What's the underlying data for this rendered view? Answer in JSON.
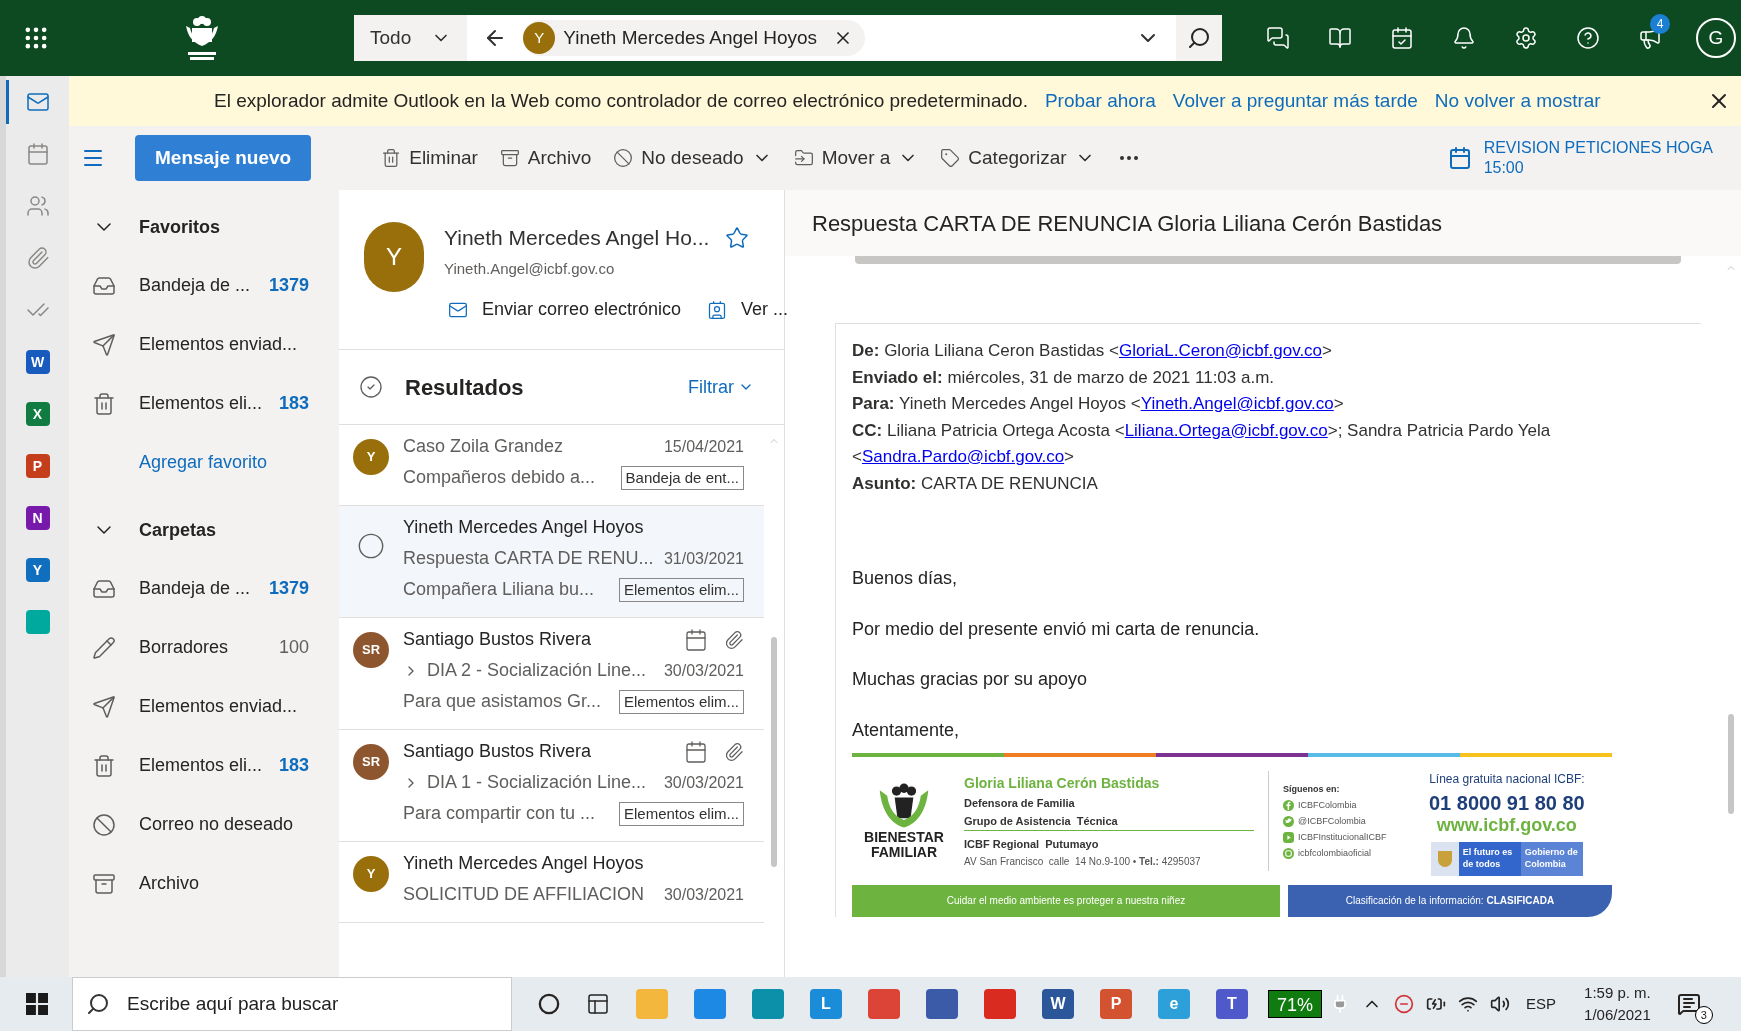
{
  "app_bar": {
    "search_scope": "Todo",
    "search_chip": {
      "initial": "Y",
      "name": "Yineth Mercedes Angel Hoyos"
    },
    "icons": [
      {
        "kind": "chat"
      },
      {
        "kind": "office"
      },
      {
        "kind": "todo"
      },
      {
        "kind": "bell"
      },
      {
        "kind": "settings"
      },
      {
        "kind": "help"
      },
      {
        "kind": "megaphone",
        "badge": "4"
      }
    ],
    "profile_initial": "G"
  },
  "rail": [
    {
      "kind": "mail",
      "selected": true
    },
    {
      "kind": "calendar",
      "selected": false
    },
    {
      "kind": "people",
      "selected": false
    },
    {
      "kind": "attach",
      "selected": false
    },
    {
      "kind": "todo",
      "selected": false
    },
    {
      "kind": "tile",
      "letter": "W",
      "color": "#185abd",
      "selected": false
    },
    {
      "kind": "tile",
      "letter": "X",
      "color": "#107c41",
      "selected": false
    },
    {
      "kind": "tile",
      "letter": "P",
      "color": "#c43e1c",
      "selected": false
    },
    {
      "kind": "tile",
      "letter": "N",
      "color": "#7719aa",
      "selected": false
    },
    {
      "kind": "tile",
      "letter": "Y",
      "color": "#106ebe",
      "selected": false
    },
    {
      "kind": "tile",
      "color": "#00a99d",
      "selected": false
    }
  ],
  "banner": {
    "message": "El explorador admite Outlook en la Web como controlador de correo electrónico predeterminado.",
    "links": [
      "Probar ahora",
      "Volver a preguntar más tarde",
      "No volver a mostrar"
    ]
  },
  "toolbar": {
    "new_message": "Mensaje nuevo",
    "actions": [
      {
        "kind": "delete",
        "label": "Eliminar",
        "dropdown": false
      },
      {
        "kind": "archive",
        "label": "Archivo",
        "dropdown": false
      },
      {
        "kind": "junk",
        "label": "No deseado",
        "dropdown": true
      },
      {
        "kind": "move",
        "label": "Mover a",
        "dropdown": true
      },
      {
        "kind": "tag",
        "label": "Categorizar",
        "dropdown": true
      }
    ],
    "reminder": {
      "title": "REVISION PETICIONES HOGA",
      "time": "15:00"
    }
  },
  "folders": [
    {
      "title": "Favoritos",
      "expanded": true,
      "items": [
        {
          "kind": "inbox",
          "label": "Bandeja de ...",
          "count": "1379",
          "unread": true
        },
        {
          "kind": "sent",
          "label": "Elementos enviad..."
        },
        {
          "kind": "deleted",
          "label": "Elementos eli...",
          "count": "183",
          "unread": true
        }
      ],
      "add_link": "Agregar favorito"
    },
    {
      "title": "Carpetas",
      "expanded": true,
      "items": [
        {
          "kind": "inbox",
          "label": "Bandeja de ...",
          "count": "1379",
          "unread": true
        },
        {
          "kind": "drafts",
          "label": "Borradores",
          "count": "100",
          "unread": false
        },
        {
          "kind": "sent",
          "label": "Elementos enviad..."
        },
        {
          "kind": "deleted",
          "label": "Elementos eli...",
          "count": "183",
          "unread": true
        },
        {
          "kind": "junk",
          "label": "Correo no deseado"
        },
        {
          "kind": "archive",
          "label": "Archivo"
        }
      ]
    }
  ],
  "contact_card": {
    "initial": "Y",
    "name": "Yineth Mercedes Angel Ho...",
    "email": "Yineth.Angel@icbf.gov.co",
    "actions": [
      {
        "kind": "mail",
        "label": "Enviar correo electrónico"
      },
      {
        "kind": "card",
        "label": "Ver ..."
      }
    ]
  },
  "results": {
    "title": "Resultados",
    "filter": "Filtrar"
  },
  "messages": [
    {
      "avatar": "Y",
      "color": "#986f0b",
      "subject": "Caso Zoila Grandez",
      "date": "15/04/2021",
      "preview": "Compañeros debido a...",
      "folder": "Bandeja de ent...",
      "selected": false,
      "thread": false,
      "calendar": false,
      "attachment": false
    },
    {
      "sender": "Yineth Mercedes Angel Hoyos",
      "subject": "Respuesta CARTA DE RENU...",
      "date": "31/03/2021",
      "preview": "Compañera Liliana bu...",
      "folder": "Elementos elim...",
      "selected": true,
      "thread": false,
      "calendar": false,
      "attachment": false
    },
    {
      "avatar": "SR",
      "color": "#8e562e",
      "sender": "Santiago Bustos Rivera",
      "subject": "DIA 2 - Socialización Line...",
      "date": "30/03/2021",
      "preview": "Para que asistamos Gr...",
      "folder": "Elementos elim...",
      "selected": false,
      "thread": true,
      "calendar": true,
      "attachment": true
    },
    {
      "avatar": "SR",
      "color": "#8e562e",
      "sender": "Santiago Bustos Rivera",
      "subject": "DIA 1 - Socialización Line...",
      "date": "30/03/2021",
      "preview": "Para compartir con tu ...",
      "folder": "Elementos elim...",
      "selected": false,
      "thread": true,
      "calendar": true,
      "attachment": true
    },
    {
      "avatar": "Y",
      "color": "#986f0b",
      "sender": "Yineth Mercedes Angel Hoyos",
      "subject": "SOLICITUD DE AFFILIACION",
      "date": "30/03/2021",
      "selected": false,
      "thread": false,
      "calendar": false,
      "attachment": false
    }
  ],
  "reading": {
    "subject": "Respuesta CARTA DE RENUNCIA Gloria Liliana Cerón Bastidas",
    "header": [
      {
        "label": "De:",
        "parts": [
          {
            "text": "Gloria Liliana Ceron Bastidas <"
          },
          {
            "link": "GloriaL.Ceron@icbf.gov.co"
          },
          {
            "text": ">"
          }
        ]
      },
      {
        "label": "Enviado el:",
        "parts": [
          {
            "text": "miércoles, 31 de marzo de 2021 11:03 a.m."
          }
        ]
      },
      {
        "label": "Para:",
        "parts": [
          {
            "text": "Yineth Mercedes Angel Hoyos <"
          },
          {
            "link": "Yineth.Angel@icbf.gov.co"
          },
          {
            "text": ">"
          }
        ]
      },
      {
        "label": "CC:",
        "parts": [
          {
            "text": "Liliana Patricia Ortega Acosta <"
          },
          {
            "link": "Liliana.Ortega@icbf.gov.co"
          },
          {
            "text": ">; Sandra Patricia Pardo Yela <"
          },
          {
            "link": "Sandra.Pardo@icbf.gov.co"
          },
          {
            "text": ">"
          }
        ]
      },
      {
        "label": "Asunto:",
        "parts": [
          {
            "text": "CARTA DE RENUNCIA"
          }
        ]
      }
    ],
    "body": [
      "Buenos días,",
      "Por medio del presente envió mi carta de renuncia.",
      "Muchas gracias por su apoyo",
      "Atentamente,"
    ],
    "signature": {
      "logo_lines": [
        "BIENESTAR",
        "FAMILIAR"
      ],
      "name": "Gloria Liliana Cerón Bastidas",
      "role": "Defensora de Familia",
      "group": "Grupo de Asistencia  Técnica",
      "regional": "ICBF Regional  Putumayo",
      "address": "AV San Francisco  calle  14 No.9-100 • **Tel.:** 4295037",
      "social_title": "Síguenos en:",
      "social": [
        {
          "kind": "facebook",
          "handle": "ICBFColombia"
        },
        {
          "kind": "twitter",
          "handle": "@ICBFColombia"
        },
        {
          "kind": "youtube",
          "handle": "ICBFInstitucionalICBF"
        },
        {
          "kind": "instagram",
          "handle": "icbfcolombiaoficial"
        }
      ],
      "hotline_label": "Línea gratuita nacional ICBF:",
      "hotline": "01 8000 91 80 80",
      "web": "www.icbf.gov.co",
      "gov_slogan": "El futuro es de todos",
      "gov_name": "Gobierno de Colombia",
      "footer_left": "Cuidar el medio ambiente es proteger a nuestra niñez",
      "footer_right": "Clasificación de la información: **CLASIFICADA**"
    }
  },
  "taskbar": {
    "search_placeholder": "Escribe aquí para buscar",
    "apps": [
      {
        "kind": "cortana"
      },
      {
        "kind": "taskview"
      },
      {
        "kind": "tile",
        "color": "#f3b73e"
      },
      {
        "kind": "tile",
        "color": "#1e88e5"
      },
      {
        "kind": "tile",
        "color": "#0c8fa8"
      },
      {
        "kind": "tile",
        "color": "#1b8cd8",
        "letter": "L"
      },
      {
        "kind": "tile",
        "color": "#db4437"
      },
      {
        "kind": "tile",
        "color": "#3b5ba9"
      },
      {
        "kind": "tile",
        "color": "#d92b1f"
      },
      {
        "kind": "tile",
        "color": "#2b579a",
        "letter": "W"
      },
      {
        "kind": "tile",
        "color": "#d35230",
        "letter": "P"
      },
      {
        "kind": "tile",
        "color": "#2d9fd9",
        "letter": "e"
      },
      {
        "kind": "tile",
        "color": "#5059c9",
        "letter": "T"
      }
    ],
    "battery": "71%",
    "language": "ESP",
    "time": "1:59 p. m.",
    "date": "1/06/2021",
    "notifications": "3"
  }
}
